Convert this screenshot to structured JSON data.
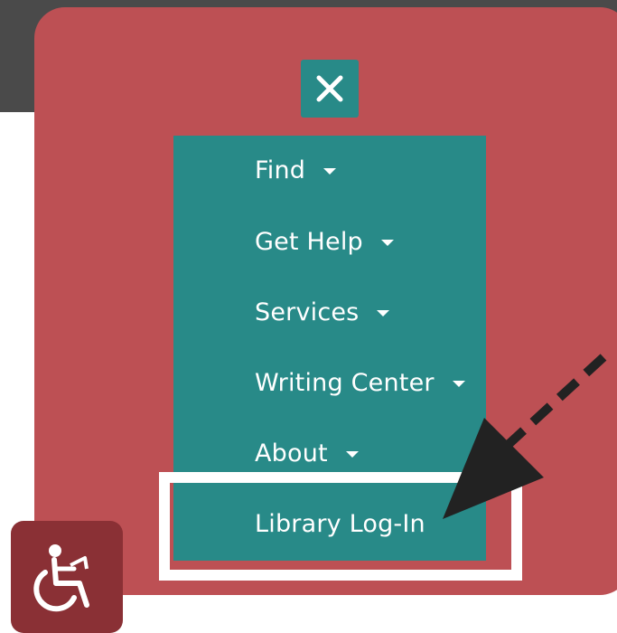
{
  "close_icon": "close-icon",
  "menu": {
    "items": [
      {
        "label": "Find",
        "has_dropdown": true
      },
      {
        "label": "Get Help",
        "has_dropdown": true
      },
      {
        "label": "Services",
        "has_dropdown": true
      },
      {
        "label": "Writing Center",
        "has_dropdown": true
      },
      {
        "label": "About",
        "has_dropdown": true
      },
      {
        "label": "Library Log-In",
        "has_dropdown": false
      }
    ]
  },
  "accessibility_icon": "wheelchair-icon",
  "colors": {
    "overlay": "#bd5054",
    "menu_panel": "#288a88",
    "accessibility_button": "#8a3035",
    "highlight_border": "#ffffff",
    "arrow": "#222222"
  }
}
